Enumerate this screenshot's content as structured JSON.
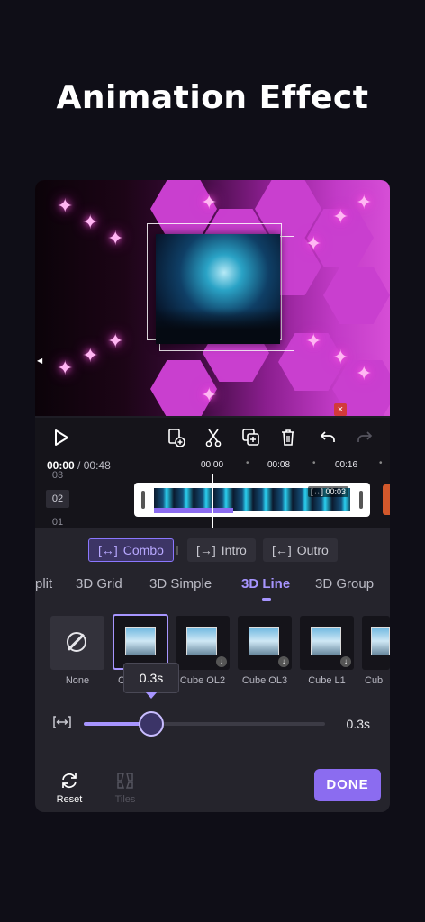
{
  "headline": "Animation Effect",
  "preview": {
    "close_glyph": "×"
  },
  "toolbar": {
    "icons": [
      "play-icon",
      "add-clip-icon",
      "split-icon",
      "duplicate-icon",
      "delete-icon",
      "undo-icon",
      "redo-icon"
    ]
  },
  "timeline": {
    "current": "00:00",
    "total": "/ 00:48",
    "ticks": [
      "00:00",
      "00:08",
      "00:16"
    ],
    "tracks": [
      "03",
      "02",
      "01"
    ],
    "clip_badge": "00:03",
    "progress": 0.0
  },
  "modes": {
    "items": [
      {
        "label": "Combo",
        "active": true
      },
      {
        "label": "Intro",
        "active": false
      },
      {
        "label": "Outro",
        "active": false
      }
    ]
  },
  "categories": [
    "plit",
    "3D Grid",
    "3D Simple",
    "3D Line",
    "3D Group"
  ],
  "active_category": "3D Line",
  "effects": [
    {
      "label": "None"
    },
    {
      "label": "C"
    },
    {
      "label": "Cube OL2"
    },
    {
      "label": "Cube OL3"
    },
    {
      "label": "Cube L1"
    },
    {
      "label": "Cub"
    }
  ],
  "selected_effect_index": 1,
  "duration": {
    "tooltip": "0.3s",
    "value_label": "0.3s",
    "fraction": 0.28
  },
  "bottom": {
    "reset_label": "Reset",
    "tiles_label": "Tiles",
    "done_label": "DONE"
  },
  "colors": {
    "accent": "#8b6cf0",
    "accent_light": "#a795ff",
    "background": "#0f0e17",
    "panel": "#25242c"
  }
}
